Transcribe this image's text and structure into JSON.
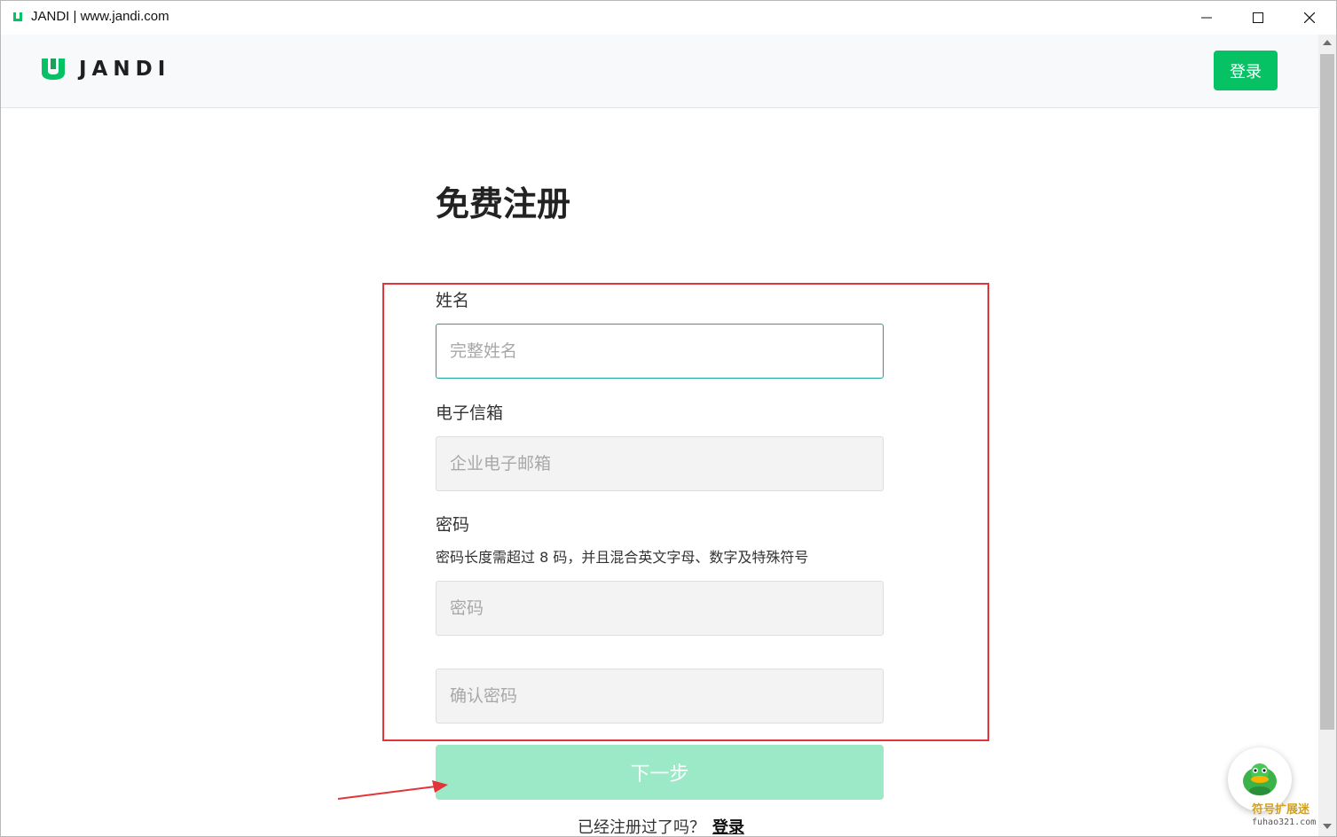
{
  "window": {
    "title": "JANDI | www.jandi.com",
    "minimize_icon": "minimize-icon",
    "maximize_icon": "maximize-icon",
    "close_icon": "close-icon"
  },
  "header": {
    "logo_text": "JANDI",
    "login_label": "登录"
  },
  "form": {
    "title": "免费注册",
    "name_label": "姓名",
    "name_placeholder": "完整姓名",
    "email_label": "电子信箱",
    "email_placeholder": "企业电子邮箱",
    "password_label": "密码",
    "password_hint": "密码长度需超过 8 码，并且混合英文字母、数字及特殊符号",
    "password_placeholder": "密码",
    "confirm_placeholder": "确认密码",
    "next_label": "下一步",
    "already_text": "已经注册过了吗？",
    "already_link": "登录"
  },
  "watermark": {
    "title": "符号扩展迷",
    "sub": "fuhao321.com"
  },
  "colors": {
    "brand_green": "#06c264",
    "next_disabled": "#9be9c6",
    "focus_border": "#1aa39a",
    "annotation_red": "#e0353b"
  }
}
